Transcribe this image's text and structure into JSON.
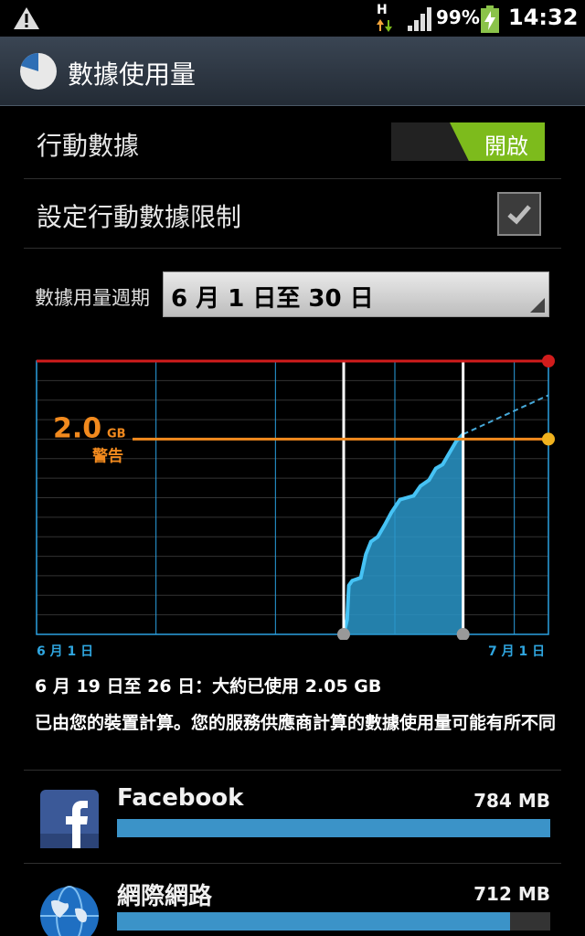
{
  "status_bar": {
    "network_type": "H",
    "battery_percent": "99%",
    "time": "14:32",
    "icons": [
      "warning-icon",
      "network-activity-icon",
      "signal-icon",
      "battery-charging-icon"
    ]
  },
  "title_bar": {
    "title": "數據使用量",
    "icon": "data-usage-pie-icon"
  },
  "settings": {
    "mobile_data": {
      "label": "行動數據",
      "toggle_state": "開啟",
      "enabled": true
    },
    "set_limit": {
      "label": "設定行動數據限制",
      "checked": true
    }
  },
  "cycle": {
    "label": "數據用量週期",
    "value": "6 月 1 日至 30 日"
  },
  "chart_data": {
    "type": "area",
    "x_start_label": "6 月 1 日",
    "x_end_label": "7 月 1 日",
    "warning_value": "2.0",
    "warning_unit": "GB",
    "warning_label": "警告",
    "selected_range_days": [
      19,
      26
    ],
    "x": [
      19,
      19.2,
      19.3,
      19.5,
      20,
      20.3,
      20.6,
      21,
      21.4,
      21.8,
      22.3,
      22.7,
      23.1,
      23.5,
      24,
      24.4,
      24.8,
      25.2,
      25.6,
      26
    ],
    "y": [
      0,
      0.15,
      0.5,
      0.55,
      0.58,
      0.82,
      0.95,
      1.0,
      1.12,
      1.25,
      1.38,
      1.4,
      1.42,
      1.52,
      1.58,
      1.7,
      1.74,
      1.86,
      1.98,
      2.05
    ],
    "ylim": [
      0,
      2.8
    ],
    "xlim": [
      1,
      31
    ],
    "warning_level": 2.0,
    "limit_level": 2.8,
    "colors": {
      "area": "#2a96c9",
      "warning": "#f28a1e",
      "limit": "#d11c1c",
      "grid": "#2aa0e0"
    }
  },
  "summary": {
    "usage": "6 月 19 日至 26 日：大約已使用 2.05 GB",
    "note": "已由您的裝置計算。您的服務供應商計算的數據使用量可能有所不同"
  },
  "apps": [
    {
      "name": "Facebook",
      "size": "784 MB",
      "fraction": 1.0,
      "icon": "facebook-icon"
    },
    {
      "name": "網際網路",
      "size": "712 MB",
      "fraction": 0.908,
      "icon": "globe-icon"
    }
  ]
}
